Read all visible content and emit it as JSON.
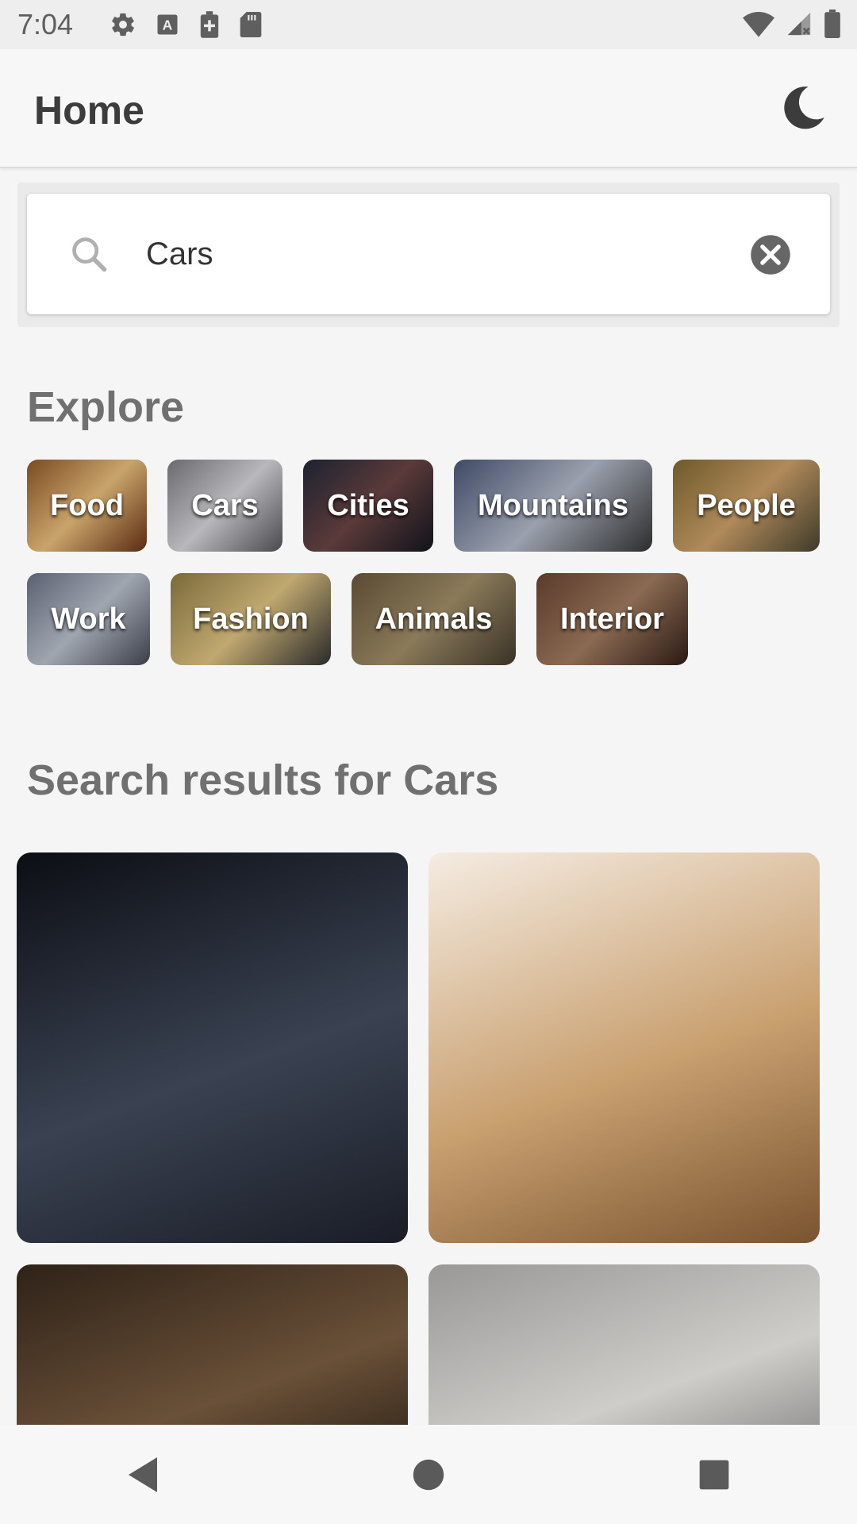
{
  "status_bar": {
    "time": "7:04",
    "left_icons": [
      "settings-icon",
      "a-badge-icon",
      "battery-plus-icon",
      "sd-card-icon"
    ],
    "right_icons": [
      "wifi-icon",
      "cell-signal-icon",
      "battery-icon"
    ]
  },
  "app_bar": {
    "title": "Home",
    "theme_icon": "moon-icon"
  },
  "search": {
    "value": "Cars",
    "placeholder": "",
    "icon": "search-icon",
    "clear_icon": "close-circle-icon"
  },
  "explore": {
    "title": "Explore",
    "chips": [
      {
        "label": "Food",
        "colors": [
          "#7a4a22",
          "#c9a46a",
          "#5a2a12"
        ]
      },
      {
        "label": "Cars",
        "colors": [
          "#6a6a6e",
          "#b8b8bc",
          "#4a4a4e"
        ]
      },
      {
        "label": "Cities",
        "colors": [
          "#1c2230",
          "#5b3a3a",
          "#10131a"
        ]
      },
      {
        "label": "Mountains",
        "colors": [
          "#3f4a66",
          "#9aa0ad",
          "#2d2d2d"
        ]
      },
      {
        "label": "People",
        "colors": [
          "#6e5a2a",
          "#b08a5a",
          "#3e3a2a"
        ]
      },
      {
        "label": "Work",
        "colors": [
          "#5a6070",
          "#a0a6b0",
          "#3a3e48"
        ]
      },
      {
        "label": "Fashion",
        "colors": [
          "#7a6a3a",
          "#c0a870",
          "#2a2a2a"
        ]
      },
      {
        "label": "Animals",
        "colors": [
          "#5a4a32",
          "#8a7a5a",
          "#3a3226"
        ]
      },
      {
        "label": "Interior",
        "colors": [
          "#5a3a2a",
          "#8a6a52",
          "#2a1a14"
        ]
      }
    ]
  },
  "results": {
    "title": "Search results for Cars",
    "tiles": [
      {
        "name": "result-image-dark-garage-car",
        "colors": [
          "#0c0e14",
          "#3a4252",
          "#1a1d26"
        ]
      },
      {
        "name": "result-image-blue-car-desert",
        "colors": [
          "#f5ece2",
          "#c9a070",
          "#7a5430"
        ]
      },
      {
        "name": "result-image-forest",
        "colors": [
          "#2e2218",
          "#6a5038",
          "#1e160e"
        ]
      },
      {
        "name": "result-image-window-room",
        "colors": [
          "#9a9896",
          "#cfcdca",
          "#6e6c6a"
        ]
      }
    ]
  },
  "nav_bar": {
    "icons": [
      "back-icon",
      "home-icon",
      "recents-icon"
    ]
  }
}
